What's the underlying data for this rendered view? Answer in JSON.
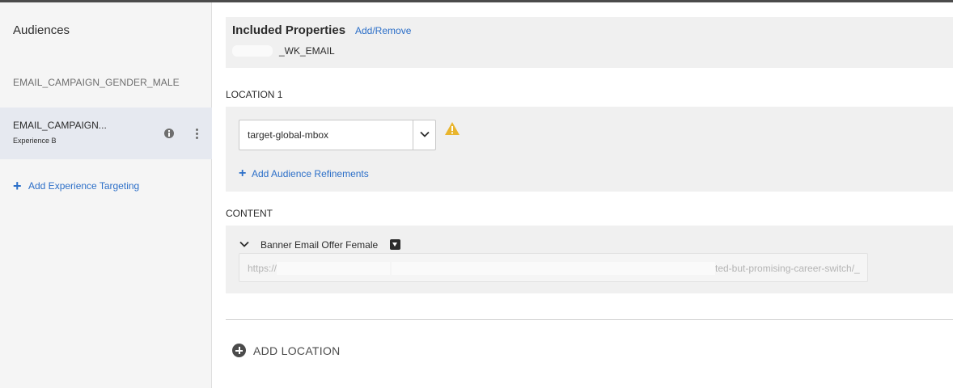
{
  "sidebar": {
    "title": "Audiences",
    "items": [
      {
        "name": "EMAIL_CAMPAIGN_GENDER_MALE"
      },
      {
        "name": "EMAIL_CAMPAIGN...",
        "experience": "Experience B"
      }
    ],
    "add_label": "Add Experience Targeting"
  },
  "properties": {
    "title": "Included Properties",
    "link": "Add/Remove",
    "value": "_WK_EMAIL"
  },
  "location": {
    "label": "LOCATION 1",
    "selected": "target-global-mbox",
    "add_refinements": "Add Audience Refinements"
  },
  "content": {
    "label": "CONTENT",
    "offer_name": "Banner Email Offer Female",
    "url_prefix": "https://",
    "url_suffix": "ted-but-promising-career-switch/_"
  },
  "add_location": "ADD LOCATION",
  "colors": {
    "accent": "#2c6fc8",
    "warning": "#e9b52d",
    "selected_bg": "#e6e9f0"
  }
}
